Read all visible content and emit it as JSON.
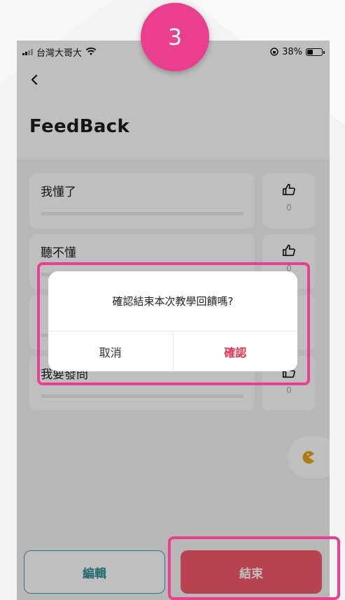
{
  "status_bar": {
    "carrier": "台灣大哥大",
    "battery": "38%",
    "battery_level": 0.38
  },
  "header": {
    "back_icon": "chevron-left-icon",
    "title": "FeedBack"
  },
  "options": [
    {
      "label": "我懂了",
      "count": "0"
    },
    {
      "label": "聽不懂",
      "count": "0"
    },
    {
      "label": "",
      "count": "0"
    },
    {
      "label": "我要發問",
      "count": "0"
    }
  ],
  "fab": {
    "icon": "pacman-icon"
  },
  "footer": {
    "edit_label": "編輯",
    "end_label": "結束"
  },
  "dialog": {
    "message": "確認結束本次教學回饋嗎?",
    "cancel_label": "取消",
    "confirm_label": "確認"
  },
  "annotation": {
    "step_number": "3"
  },
  "colors": {
    "accent": "#ea3f8e",
    "teal": "#37a5ad",
    "danger": "#f45a6c",
    "confirm": "#e8364f"
  }
}
